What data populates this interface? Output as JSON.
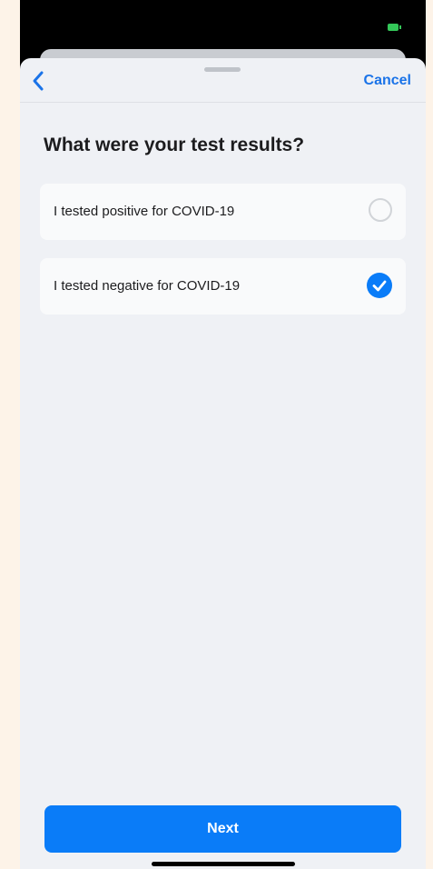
{
  "nav": {
    "cancel_label": "Cancel"
  },
  "page": {
    "title": "What were your test results?"
  },
  "options": [
    {
      "label": "I tested positive for COVID-19",
      "selected": false
    },
    {
      "label": "I tested negative for COVID-19",
      "selected": true
    }
  ],
  "footer": {
    "next_label": "Next"
  },
  "icons": {
    "back": "chevron-left-icon",
    "unchecked": "radio-unchecked-icon",
    "checked": "checkmark-circle-icon",
    "battery": "battery-icon"
  },
  "colors": {
    "accent": "#0a7cf8",
    "link": "#1a73e8",
    "sheet_background": "#eff1f5",
    "card_background": "#f9fafb"
  }
}
